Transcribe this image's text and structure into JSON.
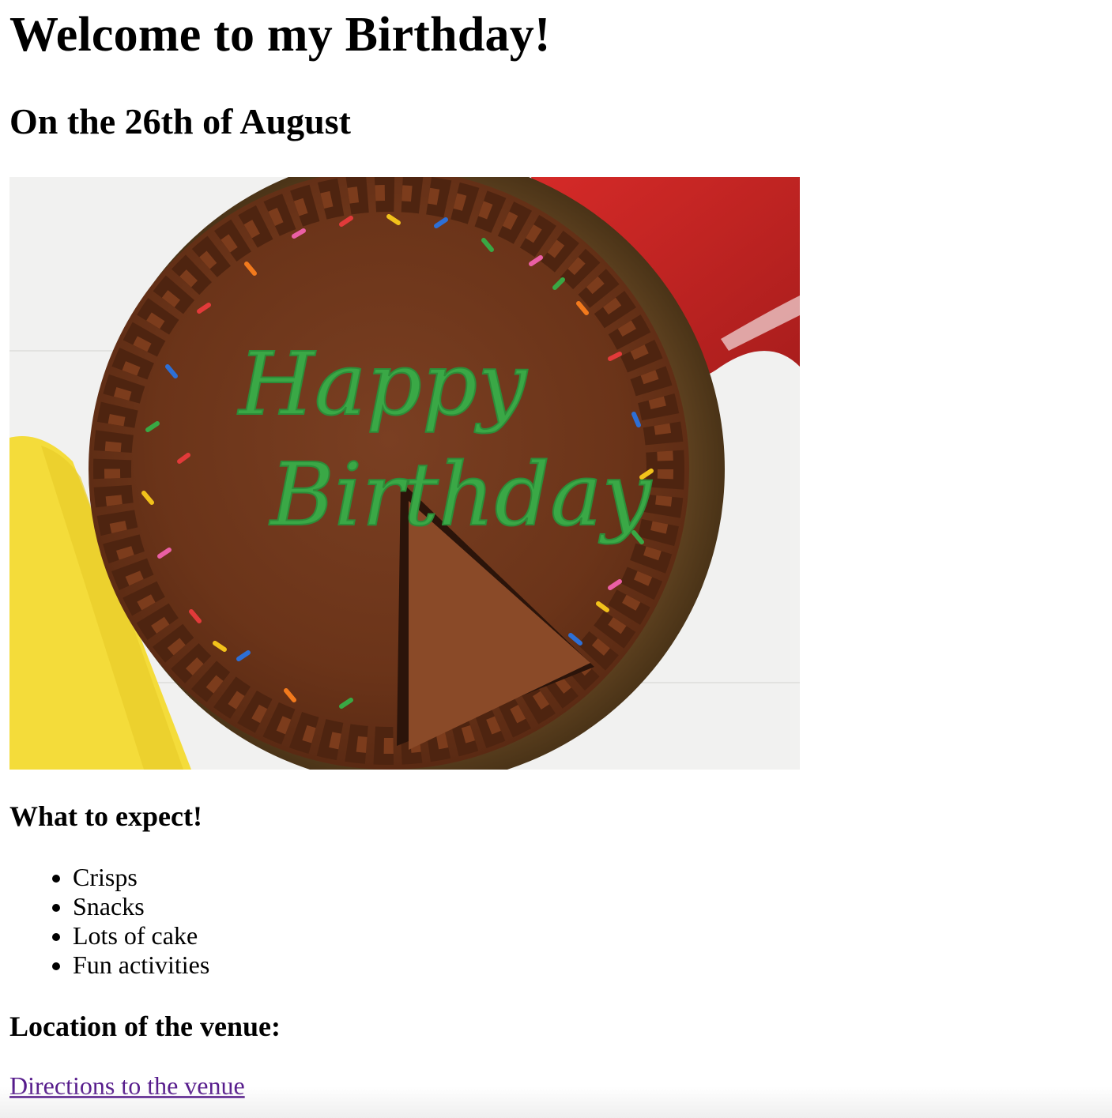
{
  "page": {
    "title": "Welcome to my Birthday!",
    "subtitle": "On the 26th of August",
    "image": {
      "icon": "birthday-cake-photo",
      "caption_text_line1": "Happy",
      "caption_text_line2": "Birthday"
    },
    "expect_heading": "What to expect!",
    "expect_items": [
      "Crisps",
      "Snacks",
      "Lots of cake",
      "Fun activities"
    ],
    "location_heading": "Location of the venue:",
    "directions_link": "Directions to the venue"
  },
  "colors": {
    "link_visited": "#551a8b",
    "text": "#000000"
  }
}
